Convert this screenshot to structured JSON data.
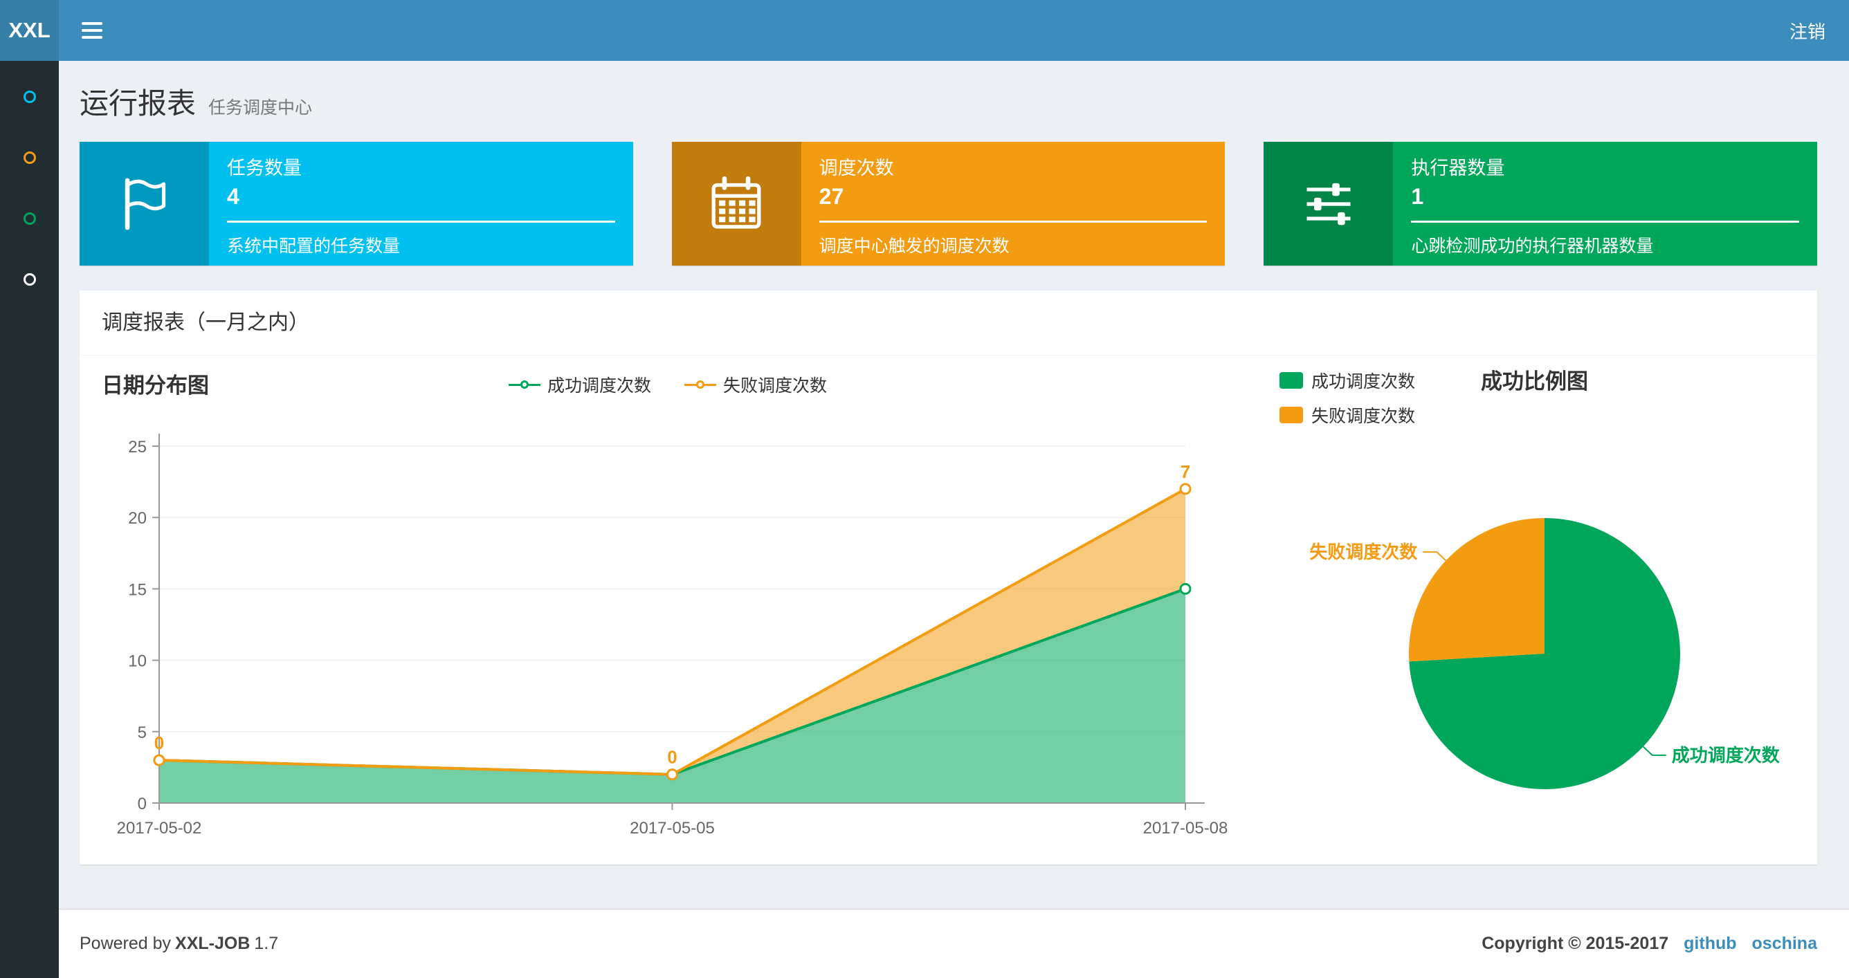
{
  "navbar": {
    "logo": "XXL",
    "logout_label": "注销"
  },
  "sidebar": {
    "items": [
      {
        "name": "menu-dashboard",
        "color": "#00c0ef"
      },
      {
        "name": "menu-jobs",
        "color": "#f39c12"
      },
      {
        "name": "menu-logs",
        "color": "#00a65a"
      },
      {
        "name": "menu-executors",
        "color": "#ffffff"
      }
    ]
  },
  "page_header": {
    "title": "运行报表",
    "subtitle": "任务调度中心"
  },
  "info_boxes": [
    {
      "label": "任务数量",
      "value": "4",
      "desc": "系统中配置的任务数量",
      "color": "#00c0ef",
      "icon": "flag-icon"
    },
    {
      "label": "调度次数",
      "value": "27",
      "desc": "调度中心触发的调度次数",
      "color": "#f39c12",
      "icon": "calendar-icon"
    },
    {
      "label": "执行器数量",
      "value": "1",
      "desc": "心跳检测成功的执行器机器数量",
      "color": "#00a65a",
      "icon": "sliders-icon"
    }
  ],
  "panel": {
    "title": "调度报表（一月之内）"
  },
  "chart_data": [
    {
      "type": "area",
      "title": "日期分布图",
      "x": [
        "2017-05-02",
        "2017-05-05",
        "2017-05-08"
      ],
      "series": [
        {
          "name": "成功调度次数",
          "values": [
            3,
            2,
            15
          ],
          "color": "#00a65a"
        },
        {
          "name": "失败调度次数",
          "values": [
            0,
            0,
            7
          ],
          "color": "#f39c12",
          "labels": [
            "0",
            "0",
            "7"
          ]
        }
      ],
      "stacked": true,
      "ylim": [
        0,
        25
      ],
      "yticks": [
        0,
        5,
        10,
        15,
        20,
        25
      ],
      "legend": [
        "成功调度次数",
        "失败调度次数"
      ],
      "legend_position": "top-center",
      "grid": false
    },
    {
      "type": "pie",
      "title": "成功比例图",
      "slices": [
        {
          "name": "成功调度次数",
          "value": 20,
          "color": "#00a65a"
        },
        {
          "name": "失败调度次数",
          "value": 7,
          "color": "#f39c12"
        }
      ],
      "legend": [
        "成功调度次数",
        "失败调度次数"
      ],
      "legend_position": "top-left"
    }
  ],
  "footer": {
    "powered_by": "Powered by",
    "product": "XXL-JOB",
    "version": "1.7",
    "copyright": "Copyright © 2015-2017",
    "links": [
      {
        "label": "github"
      },
      {
        "label": "oschina"
      }
    ]
  },
  "colors": {
    "navbar": "#3c8dbc",
    "logo_bg": "#367fa9",
    "sidebar_bg": "#222d32",
    "content_bg": "#ecf0f5"
  }
}
